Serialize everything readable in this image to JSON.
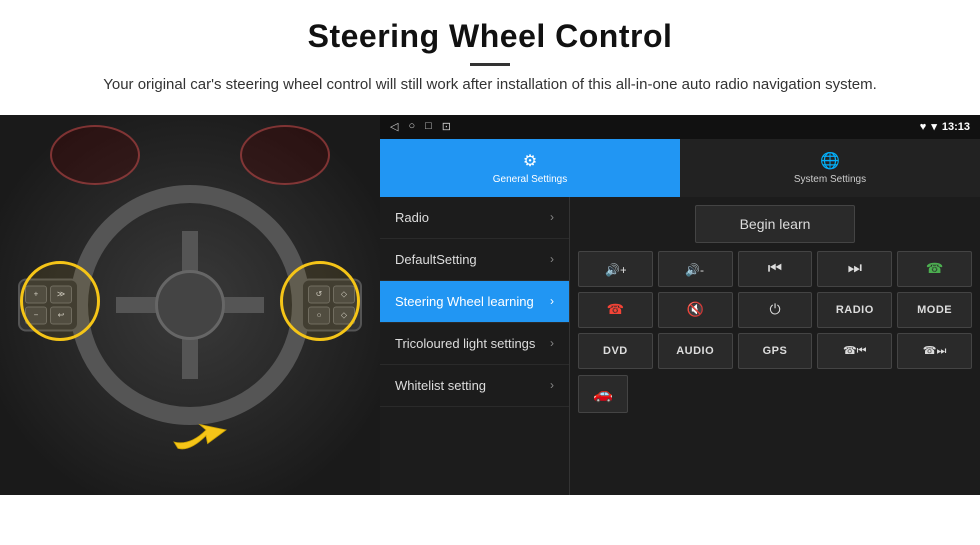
{
  "header": {
    "title": "Steering Wheel Control",
    "description": "Your original car's steering wheel control will still work after installation of this all-in-one auto radio navigation system."
  },
  "statusBar": {
    "icons": [
      "◁",
      "○",
      "□",
      "⊡"
    ],
    "time": "13:13",
    "rightIcons": [
      "♥",
      "▾"
    ]
  },
  "tabs": [
    {
      "id": "general",
      "label": "General Settings",
      "icon": "⚙",
      "active": true
    },
    {
      "id": "system",
      "label": "System Settings",
      "icon": "🌐",
      "active": false
    }
  ],
  "menuItems": [
    {
      "id": "radio",
      "label": "Radio",
      "active": false
    },
    {
      "id": "default",
      "label": "DefaultSetting",
      "active": false
    },
    {
      "id": "steering",
      "label": "Steering Wheel learning",
      "active": true
    },
    {
      "id": "tricoloured",
      "label": "Tricoloured light settings",
      "active": false
    },
    {
      "id": "whitelist",
      "label": "Whitelist setting",
      "active": false
    }
  ],
  "panel": {
    "beginLearnLabel": "Begin learn",
    "controlButtons": [
      {
        "id": "vol-up",
        "icon": "🔊+",
        "display": "🔊+"
      },
      {
        "id": "vol-down",
        "icon": "🔊-",
        "display": "🔊-"
      },
      {
        "id": "prev-track",
        "icon": "|◀◀",
        "display": "⏮"
      },
      {
        "id": "next-track",
        "icon": "▶▶|",
        "display": "⏭"
      },
      {
        "id": "phone",
        "icon": "📞",
        "display": "☎"
      },
      {
        "id": "call-end",
        "icon": "📞end",
        "display": "☎"
      },
      {
        "id": "mute",
        "icon": "🔇",
        "display": "🔇"
      },
      {
        "id": "power",
        "icon": "⏻",
        "display": "⏻"
      },
      {
        "id": "radio-btn",
        "label": "RADIO",
        "display": "RADIO"
      },
      {
        "id": "mode-btn",
        "label": "MODE",
        "display": "MODE"
      },
      {
        "id": "dvd-btn",
        "label": "DVD",
        "display": "DVD"
      },
      {
        "id": "audio-btn",
        "label": "AUDIO",
        "display": "AUDIO"
      },
      {
        "id": "gps-btn",
        "label": "GPS",
        "display": "GPS"
      },
      {
        "id": "phone2",
        "icon": "☎⏮",
        "display": "📞⏮"
      },
      {
        "id": "phone3",
        "icon": "📞⏭",
        "display": "☎⏭"
      }
    ],
    "bottomButtons": [
      {
        "id": "car-icon",
        "display": "🚗"
      }
    ]
  }
}
